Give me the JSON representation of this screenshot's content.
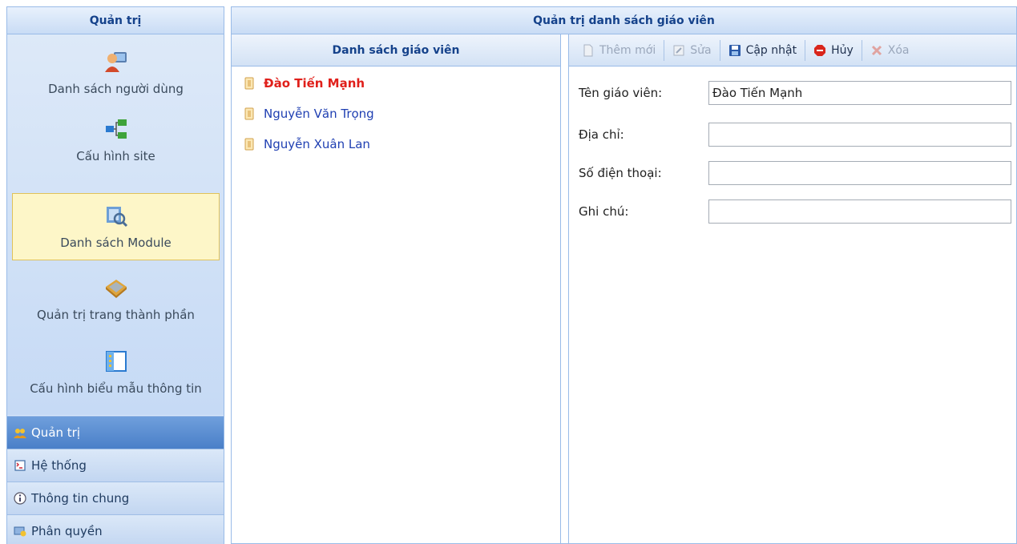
{
  "sidebar": {
    "title": "Quản trị",
    "items": [
      {
        "label": "Danh sách người dùng",
        "icon": "users-icon"
      },
      {
        "label": "Cấu hình site",
        "icon": "sitemap-icon"
      },
      {
        "label": "Danh sách Module",
        "icon": "module-icon",
        "selected": true
      },
      {
        "label": "Quản trị trang thành phần",
        "icon": "page-component-icon"
      },
      {
        "label": "Cấu hình biểu mẫu thông tin",
        "icon": "form-template-icon"
      }
    ],
    "accordion": [
      {
        "label": "Quản trị",
        "icon": "admin-icon",
        "active": true
      },
      {
        "label": "Hệ thống",
        "icon": "system-icon"
      },
      {
        "label": "Thông tin chung",
        "icon": "info-icon"
      },
      {
        "label": "Phân quyền",
        "icon": "permission-icon"
      }
    ]
  },
  "main": {
    "title": "Quản trị danh sách giáo viên",
    "list": {
      "header": "Danh sách giáo viên",
      "items": [
        {
          "label": "Đào Tiến Mạnh",
          "selected": true
        },
        {
          "label": "Nguyễn Văn Trọng"
        },
        {
          "label": "Nguyễn Xuân Lan"
        }
      ]
    },
    "toolbar": {
      "add": "Thêm mới",
      "edit": "Sửa",
      "update": "Cập nhật",
      "cancel": "Hủy",
      "delete": "Xóa"
    },
    "form": {
      "name_label": "Tên giáo viên:",
      "name_value": "Đào Tiến Mạnh",
      "address_label": "Địa chỉ:",
      "address_value": "",
      "phone_label": "Số điện thoại:",
      "phone_value": "",
      "note_label": "Ghi chú:",
      "note_value": ""
    }
  },
  "colors": {
    "header_text": "#15428b",
    "selected_text": "#e0201b",
    "link_text": "#1f3fb2",
    "active_accordion": "#4a7fc8",
    "selected_item_bg": "#fdf6c8"
  }
}
